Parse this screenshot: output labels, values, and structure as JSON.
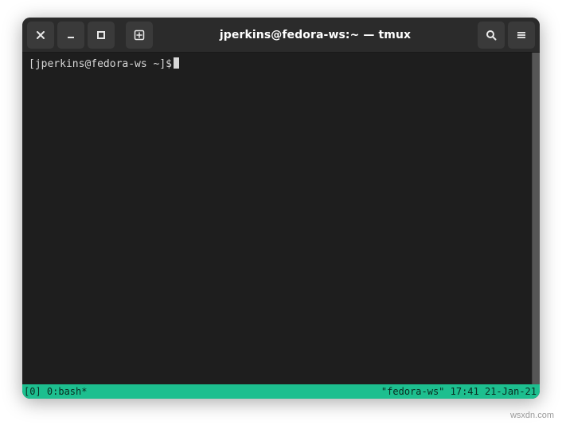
{
  "window": {
    "title": "jperkins@fedora-ws:~ — tmux"
  },
  "terminal": {
    "prompt": "[jperkins@fedora-ws ~]$"
  },
  "statusbar": {
    "left": "[0] 0:bash*",
    "right": "\"fedora-ws\" 17:41 21-Jan-21"
  },
  "watermark": "wsxdn.com",
  "icons": {
    "close": "close-icon",
    "minimize": "minimize-icon",
    "maximize": "maximize-icon",
    "new_tab": "new-tab-icon",
    "search": "search-icon",
    "menu": "hamburger-menu-icon"
  }
}
